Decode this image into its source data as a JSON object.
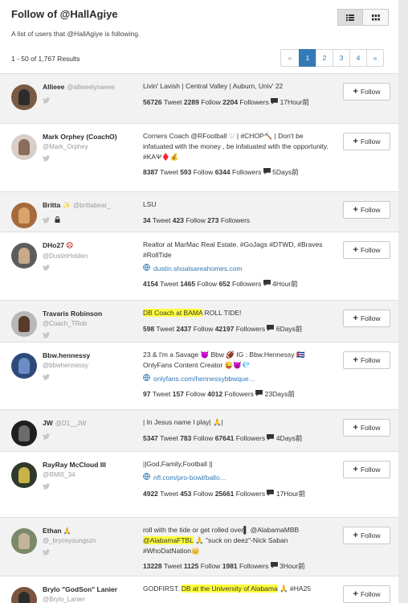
{
  "page": {
    "title": "Follow of @HallAgiye",
    "subtitle": "A list of users that @HallAgiye is following.",
    "results": "1 - 50 of 1,767 Results"
  },
  "pager": {
    "prev": "«",
    "pages": [
      "1",
      "2",
      "3",
      "4"
    ],
    "next": "»",
    "active": "1"
  },
  "follow_label": "Follow",
  "stat_labels": {
    "tweet": "Tweet",
    "follow": "Follow",
    "followers": "Followers"
  },
  "users": [
    {
      "name": "Allieee",
      "handle": "@allieeelynaeee",
      "bio": "Livin' Lavish | Central Valley | Auburn, Univ' 22",
      "tweets": "56726",
      "follows": "2289",
      "followers": "2204",
      "last": "17Hour前"
    },
    {
      "name": "Mark Orphey (CoachO)",
      "handle": "@Mark_Orphey",
      "bio": "Corners Coach @RFootball ♡ | #CHOP🔨 | Don't be infatuated with the money , be infatuated with the opportunity. #KAΨ♦️💰",
      "tweets": "8387",
      "follows": "593",
      "followers": "6344",
      "last": "5Days前"
    },
    {
      "name": "Britta",
      "handle": "@brittabear_",
      "bio": "LSU",
      "tweets": "34",
      "follows": "423",
      "followers": "273",
      "last": ""
    },
    {
      "name": "DHo27",
      "handle": "@DustinHolden",
      "bio": "Realtor at MarMac Real Estate. #GoJags #DTWD, #Braves #RollTide",
      "link": "dustin.shoalsareahomes.com",
      "tweets": "4154",
      "follows": "1465",
      "followers": "652",
      "last": "4Hour前"
    },
    {
      "name": "Travaris Robinson",
      "handle": "@Coach_TRob",
      "bio_hl": "DB Coach at BAMA",
      "bio": "ROLL TIDE!",
      "tweets": "598",
      "follows": "2437",
      "followers": "42197",
      "last": "6Days前"
    },
    {
      "name": "Bbw.hennessy",
      "handle": "@bbwhennessy",
      "bio": "23 & I'm a Savage 😈 Bbw 🏈 IG : Bbw.Hennessy 🇨🇺 OnlyFans Content Creator 😜😈💎",
      "link": "onlyfans.com/hennessybbwque…",
      "tweets": "97",
      "follows": "157",
      "followers": "4012",
      "last": "23Days前"
    },
    {
      "name": "JW",
      "handle": "@D1__JW",
      "bio": "| In Jesus name I play| 🙏|",
      "tweets": "5347",
      "follows": "783",
      "followers": "67641",
      "last": "4Days前"
    },
    {
      "name": "RayRay McCloud III",
      "handle": "@RMIII_34",
      "bio": "||God,Family,Football ||",
      "link": "nfl.com/pro-bowl/ballo…",
      "tweets": "4922",
      "follows": "453",
      "followers": "25661",
      "last": "17Hour前"
    },
    {
      "name": "Ethan",
      "handle": "@_bryceyoungszn",
      "bio_pre": "roll with the tide or get rolled over▌ @AlabamaMBB",
      "bio_hl": "@AlabamaFTBL",
      "bio": "🙏 \"suck on deez\"-Nick Saban #WhoDatNation👑",
      "tweets": "13228",
      "follows": "1125",
      "followers": "1981",
      "last": "3Hour前"
    },
    {
      "name": "Brylo \"GodSon\" Lanier",
      "handle": "@Brylo_Lanier",
      "bio_pre": "GODFIRST.",
      "bio_hl": "DB at the University of Alabama",
      "bio": "🙏 #HA25",
      "tweets": "",
      "follows": "",
      "followers": "",
      "last": ""
    }
  ],
  "colors": {
    "accent": "#337ab7",
    "highlight": "#ffff3d",
    "row_alt": "#f2f2f2"
  }
}
